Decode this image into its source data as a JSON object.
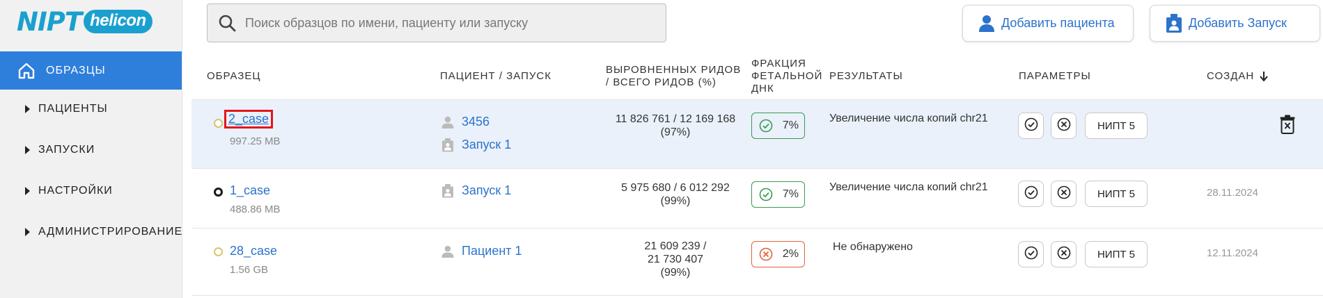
{
  "app": {
    "logo_main": "NIPT",
    "logo_pill": "helicon"
  },
  "sidebar": {
    "active": {
      "label": "ОБРАЗЦЫ",
      "icon": "home-icon"
    },
    "items": [
      {
        "label": "ПАЦИЕНТЫ"
      },
      {
        "label": "ЗАПУСКИ"
      },
      {
        "label": "НАСТРОЙКИ"
      },
      {
        "label": "АДМИНИСТРИРОВАНИЕ"
      }
    ]
  },
  "search": {
    "placeholder": "Поиск образцов по имени, пациенту или запуску",
    "value": ""
  },
  "actions": {
    "add_patient": "Добавить пациента",
    "add_run": "Добавить Запуск"
  },
  "table": {
    "headers": {
      "sample": "ОБРАЗЕЦ",
      "patient_run": "ПАЦИЕНТ / ЗАПУСК",
      "reads_1": "ВЫРОВНЕННЫХ РИДОВ",
      "reads_2": "/ ВСЕГО РИДОВ (%)",
      "ff_1": "ФРАКЦИЯ",
      "ff_2": "ФЕТАЛЬНОЙ",
      "ff_3": "ДНК",
      "results": "РЕЗУЛЬТАТЫ",
      "params": "ПАРАМЕТРЫ",
      "created": "СОЗДАН"
    },
    "sort_icon": "arrow-down-icon",
    "rows": [
      {
        "status_color": "#d9c56e",
        "name": "2_case",
        "size": "997.25 MB",
        "patient": "3456",
        "run": "Запуск 1",
        "reads_1": "11 826 761 / 12 169 168",
        "reads_2": "(97%)",
        "ff_value": "7%",
        "ff_status": "ok",
        "result": "Увеличение числа копий chr21",
        "param": "НИПТ 5",
        "created": ""
      },
      {
        "status_color": "#1a1a1a",
        "name": "1_case",
        "size": "488.86 MB",
        "run": "Запуск 1",
        "reads_1": "5 975 680 / 6 012 292",
        "reads_2": "(99%)",
        "ff_value": "7%",
        "ff_status": "ok",
        "result": "Увеличение числа копий chr21",
        "param": "НИПТ 5",
        "created": "28.11.2024"
      },
      {
        "status_color": "#d9c56e",
        "name": "28_case",
        "size": "1.56 GB",
        "patient": "Пациент 1",
        "reads_1": "21 609 239 /",
        "reads_2": "21 730 407",
        "reads_3": "(99%)",
        "ff_value": "2%",
        "ff_status": "bad",
        "result": "Не обнаружено",
        "param": "НИПТ 5",
        "created": "12.11.2024"
      }
    ]
  },
  "colors": {
    "accent": "#2e7fdc",
    "link": "#2b73cc",
    "ff_ok": "#3a9a52",
    "ff_bad": "#e2623a",
    "highlight_box": "#e6141c",
    "selected_row": "#eaf1fa"
  }
}
